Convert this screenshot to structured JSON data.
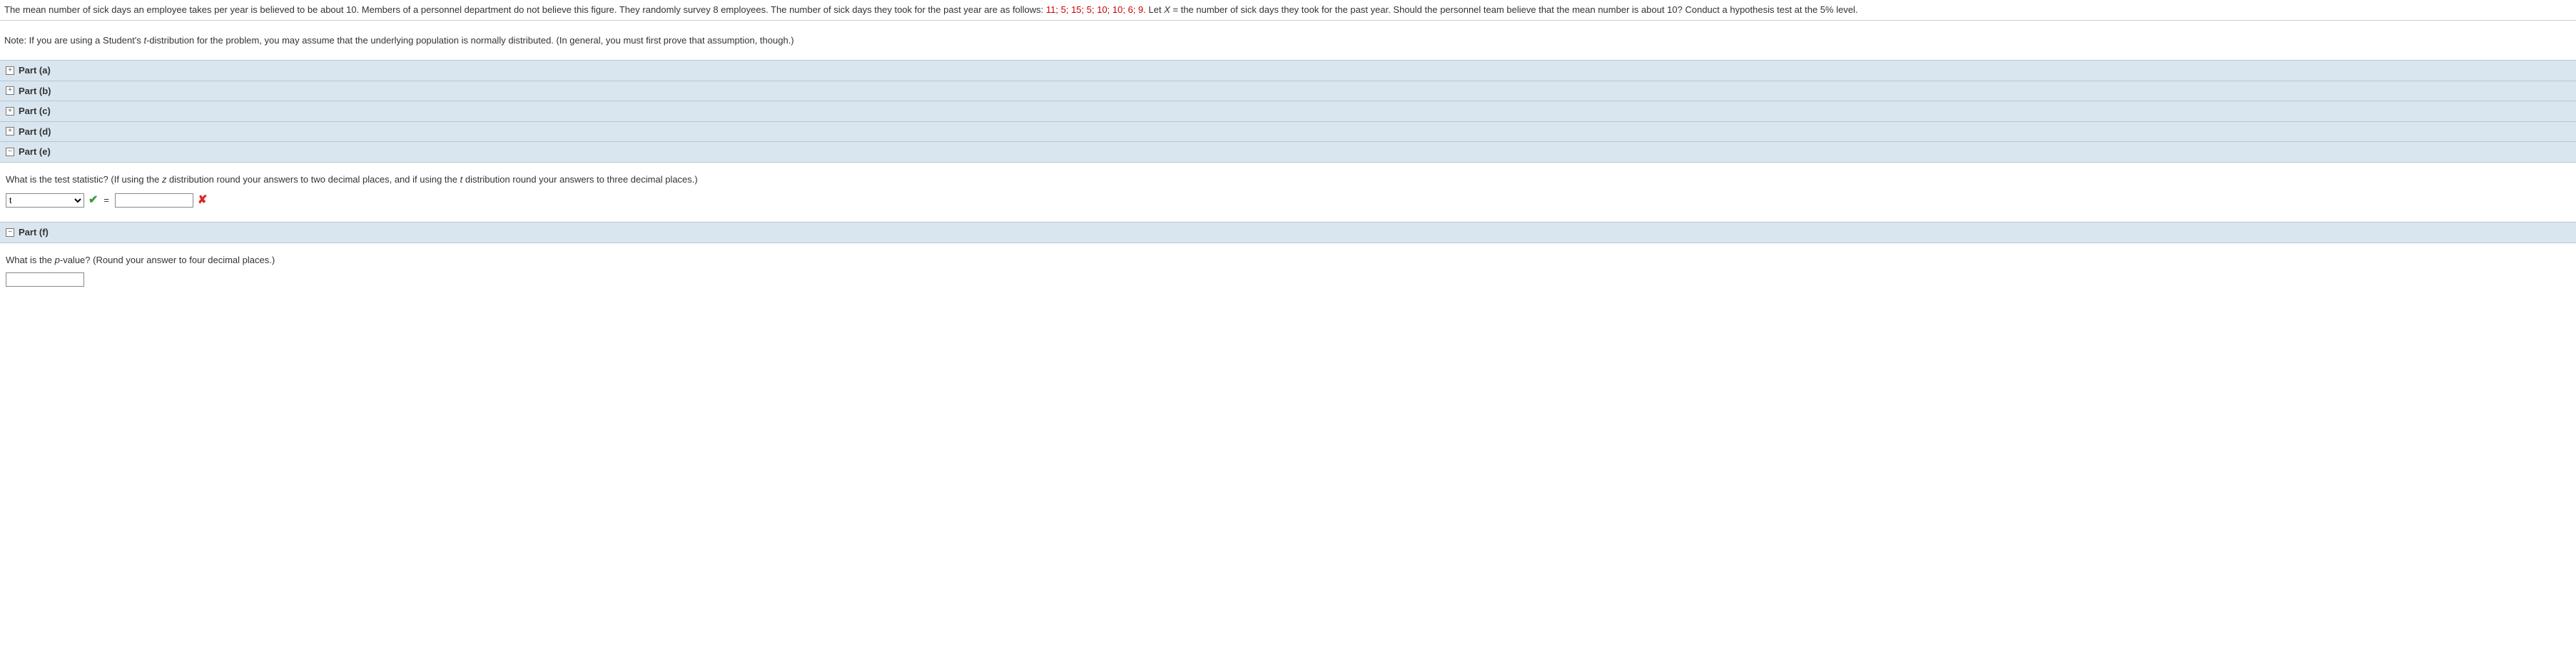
{
  "problem": {
    "line1a": "The mean number of sick days an employee takes per year is believed to be about 10. Members of a personnel department do not believe this figure. They randomly survey 8 employees. The number of sick days they took for the past year are as follows: ",
    "data_values": "11; 5; 15; 5; 10; 10; 6; 9.",
    "line1b": " Let ",
    "var_x": "X",
    "line1c": " = the number of sick days they took for the past year. Should the personnel team believe that the mean number is about 10? Conduct a hypothesis test at the 5% level."
  },
  "note": {
    "prefix": "Note: If you are using a Student's ",
    "ital1": "t",
    "mid": "-distribution for the problem, you may assume that the underlying population is normally distributed. (In general, you must first prove that assumption, though.)"
  },
  "parts": {
    "a": {
      "label": "Part (a)",
      "expanded": false,
      "icon": "+"
    },
    "b": {
      "label": "Part (b)",
      "expanded": false,
      "icon": "+"
    },
    "c": {
      "label": "Part (c)",
      "expanded": false,
      "icon": "+"
    },
    "d": {
      "label": "Part (d)",
      "expanded": false,
      "icon": "+"
    },
    "e": {
      "label": "Part (e)",
      "expanded": true,
      "icon": "−"
    },
    "f": {
      "label": "Part (f)",
      "expanded": true,
      "icon": "−"
    }
  },
  "parte": {
    "question_a": "What is the test statistic? (If using the ",
    "ital_z": "z",
    "question_b": " distribution round your answers to two decimal places, and if using the ",
    "ital_t": "t",
    "question_c": " distribution round your answers to three decimal places.)",
    "select_value": "t",
    "equals": "=",
    "input_value": ""
  },
  "partf": {
    "question_a": "What is the ",
    "ital_p": "p",
    "question_b": "-value? (Round your answer to four decimal places.)",
    "input_value": ""
  }
}
